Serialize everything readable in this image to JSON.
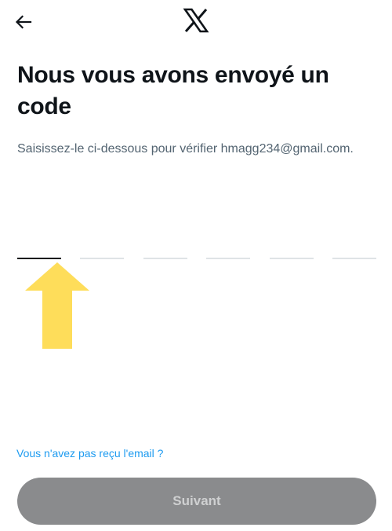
{
  "header": {
    "back_icon": "arrow-left-icon",
    "logo_icon": "x-logo-icon"
  },
  "main": {
    "title": "Nous vous avons envoyé un code",
    "subtitle": "Saisissez-le ci-dessous pour vérifier hmagg234@gmail.com."
  },
  "code": {
    "slots": [
      "",
      "",
      "",
      "",
      "",
      ""
    ]
  },
  "annotation": {
    "icon": "up-arrow-annotation-icon",
    "color": "#fedd5a"
  },
  "footer": {
    "resend_link": "Vous n'avez pas reçu l'email ?",
    "next_button": "Suivant"
  },
  "colors": {
    "text": "#0f1419",
    "secondary_text": "#536471",
    "link": "#1d9bf0",
    "button_disabled_bg": "#8a8b8d",
    "button_disabled_text": "#cfd0d1",
    "slot_border": "#dfe3e6"
  }
}
